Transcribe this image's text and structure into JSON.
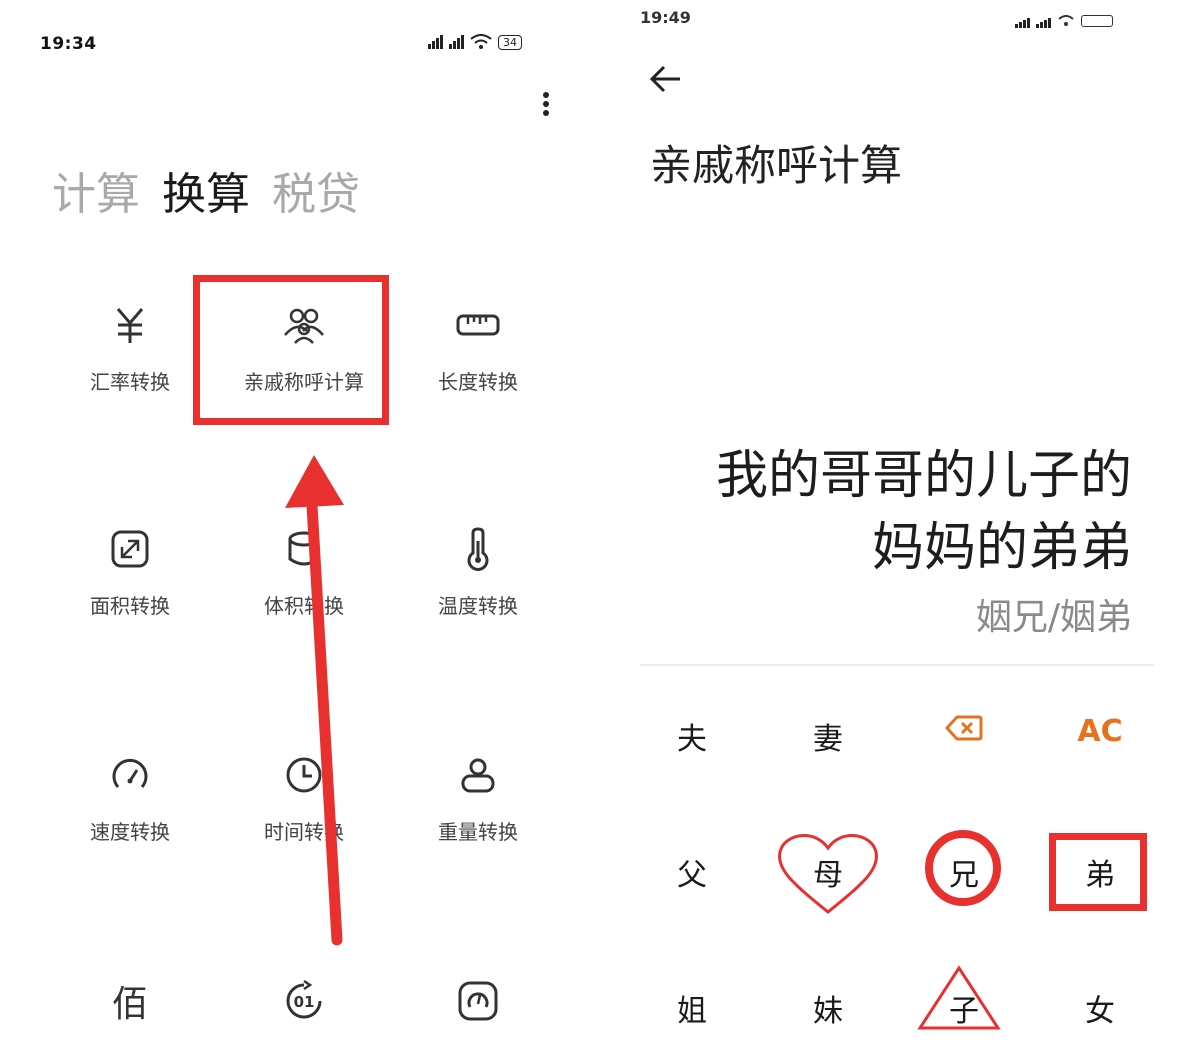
{
  "left": {
    "status": {
      "time": "19:34",
      "battery": "34"
    },
    "tabs": [
      {
        "label": "计算",
        "active": false
      },
      {
        "label": "换算",
        "active": true
      },
      {
        "label": "税贷",
        "active": false
      }
    ],
    "grid": [
      {
        "label": "汇率转换",
        "icon": "yen-icon"
      },
      {
        "label": "亲戚称呼计算",
        "icon": "people-icon"
      },
      {
        "label": "长度转换",
        "icon": "ruler-icon"
      },
      {
        "label": "面积转换",
        "icon": "area-icon"
      },
      {
        "label": "体积转换",
        "icon": "cube-icon"
      },
      {
        "label": "温度转换",
        "icon": "thermometer-icon"
      },
      {
        "label": "速度转换",
        "icon": "speedometer-icon"
      },
      {
        "label": "时间转换",
        "icon": "clock-icon"
      },
      {
        "label": "重量转换",
        "icon": "weight-icon"
      },
      {
        "label": "佰",
        "icon": "hundred-icon"
      },
      {
        "label": "",
        "icon": "binary-icon"
      },
      {
        "label": "",
        "icon": "gauge-icon"
      }
    ],
    "binary_text": "01"
  },
  "right": {
    "status": {
      "time": "19:49"
    },
    "title": "亲戚称呼计算",
    "expression": [
      "我的哥哥的儿子的",
      "妈妈的弟弟"
    ],
    "result": "姻兄/姻弟",
    "keypad": [
      [
        "夫",
        "妻",
        "⌫",
        "AC"
      ],
      [
        "父",
        "母",
        "兄",
        "弟"
      ],
      [
        "姐",
        "妹",
        "子",
        "女"
      ]
    ]
  },
  "colors": {
    "highlight": "#e8312e",
    "accent": "#e8711e"
  }
}
